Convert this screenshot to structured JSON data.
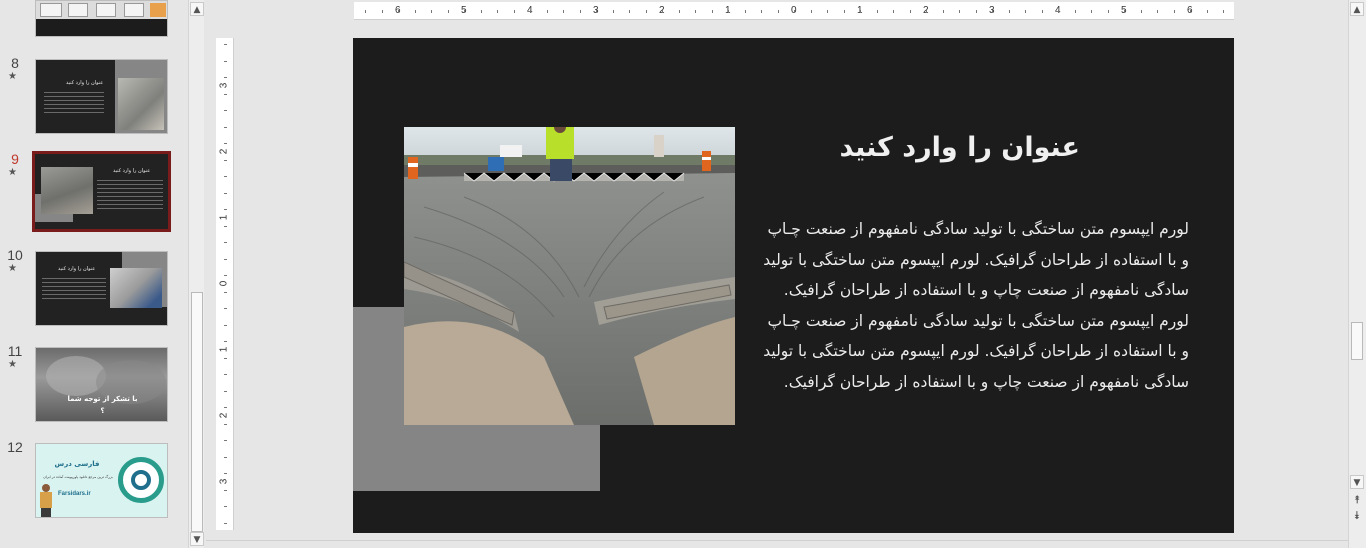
{
  "thumbnails": [
    {
      "num": "8",
      "star": "★",
      "title": "عنوان را وارد کنید",
      "selected": false
    },
    {
      "num": "9",
      "star": "★",
      "title": "عنوان را وارد کنید",
      "selected": true
    },
    {
      "num": "10",
      "star": "★",
      "title": "عنوان را وارد کنید",
      "selected": false
    },
    {
      "num": "11",
      "star": "★",
      "title": "با تشکر از توجه شما",
      "title2": "؟",
      "selected": false
    },
    {
      "num": "12",
      "star": "",
      "brand": "فارسی درس",
      "tagline": "بزرگ ترین مرجع دانلود پاورپوینت آماده در ایران",
      "site": "Farsidars.ir",
      "selected": false
    }
  ],
  "ruler": {
    "horizontal": [
      "6",
      "5",
      "4",
      "3",
      "2",
      "1",
      "0",
      "1",
      "2",
      "3",
      "4",
      "5",
      "6"
    ],
    "vertical": [
      "3",
      "2",
      "1",
      "0",
      "1",
      "2",
      "3"
    ]
  },
  "slide": {
    "title": "عنوان را وارد کنید",
    "body": "لورم ایپسوم متن ساختگی با تولید سادگی نامفهوم از صنعت چـاپ و با استفاده از طراحان گرافیک. لورم ایپسوم متن ساختگی با تولید سادگی نامفهوم از صنعت چاپ و با استفاده از طراحان گرافیک. لورم ایپسوم متن ساختگی با تولید سادگی نامفهوم از صنعت چـاپ و با استفاده از طراحان گرافیک. لورم ایپسوم متن ساختگی با تولید سادگی نامفهوم از صنعت چاپ و با استفاده از طراحان گرافیک.",
    "body_lines": [
      "لورم ایپسوم متن ساختگی با تولید سادگی نامفهوم از صنعت چـاپ",
      "و با استفاده از طراحان گرافیک. لورم ایپسوم متن ساختگی با تولید",
      "سادگی نامفهوم از صنعت چاپ و با استفاده از طراحان گرافیک.",
      "لورم ایپسوم متن ساختگی با تولید سادگی نامفهوم از صنعت چـاپ",
      "و با استفاده از طراحان گرافیک. لورم ایپسوم متن ساختگی با تولید",
      "سادگی نامفهوم از صنعت چاپ و با استفاده از طراحان گرافیک."
    ]
  },
  "scroll": {
    "up": "▲",
    "down": "▼",
    "prev_slide": "⯭",
    "next_slide": "⯯"
  },
  "colors": {
    "slide_bg": "#1c1c1c",
    "accent_gray": "#858585",
    "selected_border": "#7a1c1c",
    "selected_num": "#c0392b"
  }
}
